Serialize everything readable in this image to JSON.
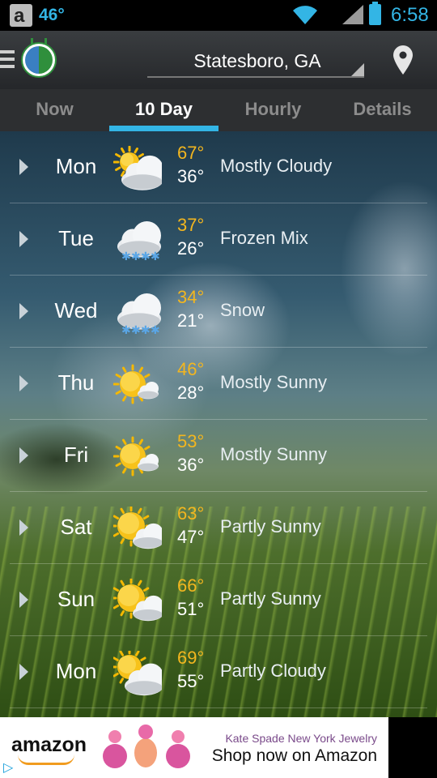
{
  "status_bar": {
    "notification_temp": "46°",
    "time": "6:58"
  },
  "header": {
    "location": "Statesboro, GA"
  },
  "tabs": [
    {
      "label": "Now",
      "active": false
    },
    {
      "label": "10 Day",
      "active": true
    },
    {
      "label": "Hourly",
      "active": false
    },
    {
      "label": "Details",
      "active": false
    }
  ],
  "forecast": [
    {
      "day": "Mon",
      "high": "67°",
      "low": "36°",
      "condition": "Mostly Cloudy",
      "icon": "mostly-cloudy-icon"
    },
    {
      "day": "Tue",
      "high": "37°",
      "low": "26°",
      "condition": "Frozen Mix",
      "icon": "frozen-mix-icon"
    },
    {
      "day": "Wed",
      "high": "34°",
      "low": "21°",
      "condition": "Snow",
      "icon": "snow-icon"
    },
    {
      "day": "Thu",
      "high": "46°",
      "low": "28°",
      "condition": "Mostly Sunny",
      "icon": "mostly-sunny-icon"
    },
    {
      "day": "Fri",
      "high": "53°",
      "low": "36°",
      "condition": "Mostly Sunny",
      "icon": "mostly-sunny-icon"
    },
    {
      "day": "Sat",
      "high": "63°",
      "low": "47°",
      "condition": "Partly Sunny",
      "icon": "partly-sunny-icon"
    },
    {
      "day": "Sun",
      "high": "66°",
      "low": "51°",
      "condition": "Partly Sunny",
      "icon": "partly-sunny-icon"
    },
    {
      "day": "Mon",
      "high": "69°",
      "low": "55°",
      "condition": "Partly Cloudy",
      "icon": "partly-cloudy-icon"
    }
  ],
  "ad": {
    "brand": "amazon",
    "line1": "Kate Spade New York Jewelry",
    "line2": "Shop now on Amazon"
  },
  "colors": {
    "accent": "#33b5e5",
    "high_temp": "#f3b61f"
  }
}
